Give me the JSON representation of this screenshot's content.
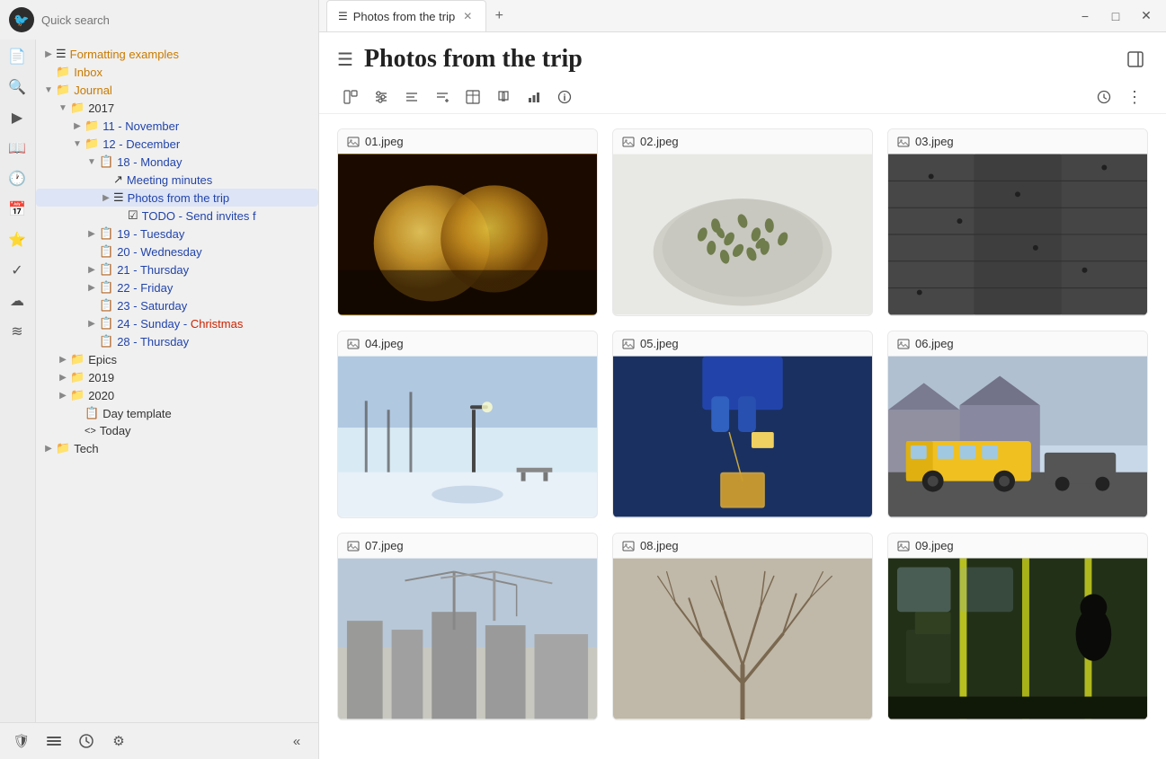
{
  "app": {
    "logo": "🐦",
    "search_placeholder": "Quick search"
  },
  "nav_icons": [
    {
      "name": "document-icon",
      "symbol": "📄",
      "label": "Document"
    },
    {
      "name": "search-icon",
      "symbol": "🔍",
      "label": "Search"
    },
    {
      "name": "send-icon",
      "symbol": "▷",
      "label": "Send"
    },
    {
      "name": "book-icon",
      "symbol": "📖",
      "label": "Book"
    },
    {
      "name": "clock-icon",
      "symbol": "🕐",
      "label": "Clock"
    },
    {
      "name": "calendar-icon",
      "symbol": "📅",
      "label": "Calendar"
    },
    {
      "name": "star-icon",
      "symbol": "⭐",
      "label": "Star"
    },
    {
      "name": "check-icon",
      "symbol": "✓",
      "label": "Check"
    },
    {
      "name": "cloud-icon",
      "symbol": "☁",
      "label": "Cloud"
    },
    {
      "name": "layers-icon",
      "symbol": "≋",
      "label": "Layers"
    }
  ],
  "sidebar": {
    "items": [
      {
        "id": "formatting",
        "label": "Formatting examples",
        "indent": 0,
        "arrow": "▶",
        "icon": "☰",
        "color": "orange"
      },
      {
        "id": "inbox",
        "label": "Inbox",
        "indent": 0,
        "arrow": "",
        "icon": "📁",
        "color": "orange"
      },
      {
        "id": "journal",
        "label": "Journal",
        "indent": 0,
        "arrow": "▼",
        "icon": "📁",
        "color": "orange"
      },
      {
        "id": "2017",
        "label": "2017",
        "indent": 1,
        "arrow": "▼",
        "icon": "📁",
        "color": ""
      },
      {
        "id": "11-november",
        "label": "11 - November",
        "indent": 2,
        "arrow": "▶",
        "icon": "📁",
        "color": "blue"
      },
      {
        "id": "12-december",
        "label": "12 - December",
        "indent": 2,
        "arrow": "▼",
        "icon": "📁",
        "color": "blue"
      },
      {
        "id": "18-monday",
        "label": "18 - Monday",
        "indent": 3,
        "arrow": "▼",
        "icon": "📋",
        "color": "blue"
      },
      {
        "id": "meeting-minutes",
        "label": "Meeting minutes",
        "indent": 4,
        "arrow": "",
        "icon": "↗",
        "color": "blue"
      },
      {
        "id": "photos-trip",
        "label": "Photos from the trip",
        "indent": 4,
        "arrow": "▶",
        "icon": "☰",
        "color": "blue",
        "selected": true
      },
      {
        "id": "todo-invites",
        "label": "TODO - Send invites f",
        "indent": 5,
        "arrow": "",
        "icon": "☑",
        "color": "blue"
      },
      {
        "id": "19-tuesday",
        "label": "19 - Tuesday",
        "indent": 3,
        "arrow": "▶",
        "icon": "📋",
        "color": "blue"
      },
      {
        "id": "20-wednesday",
        "label": "20 - Wednesday",
        "indent": 3,
        "arrow": "",
        "icon": "📋",
        "color": "blue"
      },
      {
        "id": "21-thursday",
        "label": "21 - Thursday",
        "indent": 3,
        "arrow": "▶",
        "icon": "📋",
        "color": "blue"
      },
      {
        "id": "22-friday",
        "label": "22 - Friday",
        "indent": 3,
        "arrow": "▶",
        "icon": "📋",
        "color": "blue"
      },
      {
        "id": "23-saturday",
        "label": "23 - Saturday",
        "indent": 3,
        "arrow": "",
        "icon": "📋",
        "color": "blue"
      },
      {
        "id": "24-sunday",
        "label": "24 - Sunday - Christmas",
        "indent": 3,
        "arrow": "▶",
        "icon": "📋",
        "color": "red"
      },
      {
        "id": "28-thursday",
        "label": "28 - Thursday",
        "indent": 3,
        "arrow": "",
        "icon": "📋",
        "color": "blue"
      },
      {
        "id": "epics",
        "label": "Epics",
        "indent": 1,
        "arrow": "▶",
        "icon": "📁",
        "color": ""
      },
      {
        "id": "2019",
        "label": "2019",
        "indent": 1,
        "arrow": "▶",
        "icon": "📁",
        "color": ""
      },
      {
        "id": "2020",
        "label": "2020",
        "indent": 1,
        "arrow": "▶",
        "icon": "📁",
        "color": ""
      },
      {
        "id": "day-template",
        "label": "Day template",
        "indent": 2,
        "arrow": "",
        "icon": "📋",
        "color": ""
      },
      {
        "id": "today",
        "label": "Today",
        "indent": 2,
        "arrow": "",
        "icon": "<>",
        "color": ""
      },
      {
        "id": "tech",
        "label": "Tech",
        "indent": 0,
        "arrow": "▶",
        "icon": "📁",
        "color": ""
      }
    ]
  },
  "tab": {
    "label": "Photos from the trip",
    "close": "✕",
    "add": "+"
  },
  "window_controls": {
    "minimize": "−",
    "maximize": "□",
    "close": "✕"
  },
  "page": {
    "icon": "☰",
    "title": "Photos from the trip"
  },
  "toolbar": {
    "btns": [
      {
        "name": "layout-icon",
        "symbol": "☰"
      },
      {
        "name": "sliders-icon",
        "symbol": "⚙"
      },
      {
        "name": "align-icon",
        "symbol": "≡"
      },
      {
        "name": "align-plus-icon",
        "symbol": "≡+"
      },
      {
        "name": "table-icon",
        "symbol": "⊞"
      },
      {
        "name": "book2-icon",
        "symbol": "📖"
      },
      {
        "name": "chart-icon",
        "symbol": "📊"
      },
      {
        "name": "info-icon",
        "symbol": "ℹ"
      }
    ],
    "right_btns": [
      {
        "name": "history-icon",
        "symbol": "🕐"
      },
      {
        "name": "more-icon",
        "symbol": "⋮"
      }
    ]
  },
  "gallery": {
    "items": [
      {
        "id": "01",
        "label": "01.jpeg",
        "img_class": "img-coins"
      },
      {
        "id": "02",
        "label": "02.jpeg",
        "img_class": "img-seeds"
      },
      {
        "id": "03",
        "label": "03.jpeg",
        "img_class": "img-wood"
      },
      {
        "id": "04",
        "label": "04.jpeg",
        "img_class": "img-snow"
      },
      {
        "id": "05",
        "label": "05.jpeg",
        "img_class": "img-teabag"
      },
      {
        "id": "06",
        "label": "06.jpeg",
        "img_class": "img-bus-school"
      },
      {
        "id": "07",
        "label": "07.jpeg",
        "img_class": "img-cranes"
      },
      {
        "id": "08",
        "label": "08.jpeg",
        "img_class": "img-branches"
      },
      {
        "id": "09",
        "label": "09.jpeg",
        "img_class": "img-bus-inside"
      }
    ]
  },
  "footer": {
    "layers_label": "Layers",
    "circle_label": "Circle",
    "settings_label": "Settings",
    "collapse_label": "«"
  }
}
